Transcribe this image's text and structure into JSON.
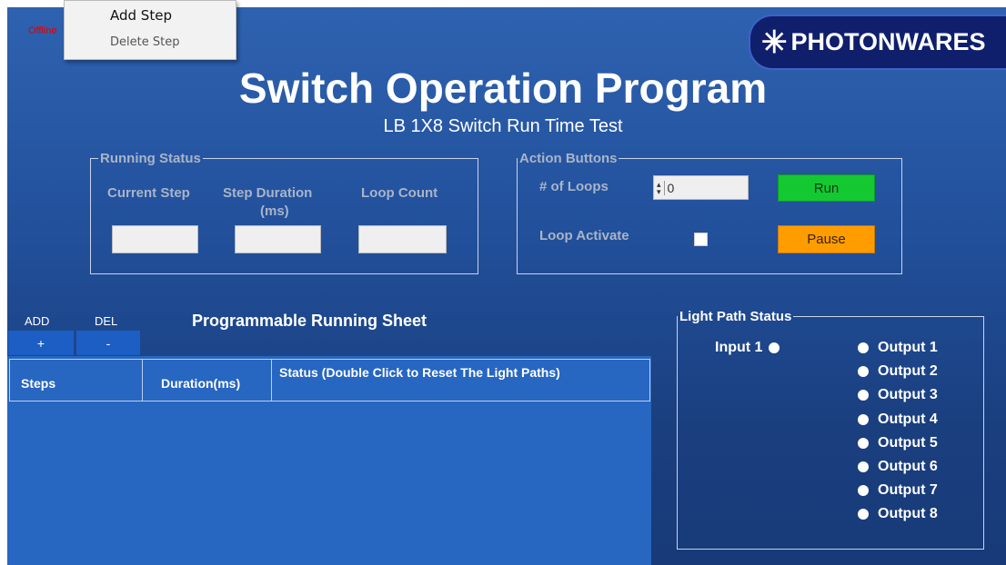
{
  "status": "Offline",
  "context_menu": {
    "items": [
      "Add Step",
      "Delete Step"
    ]
  },
  "logo_text": "PHOTONWARES",
  "title": "Switch Operation Program",
  "subtitle": "LB 1X8 Switch Run Time Test",
  "running_status": {
    "legend": "Running Status",
    "current_step_label": "Current Step",
    "step_duration_label": "Step Duration",
    "step_duration_unit": "(ms)",
    "loop_count_label": "Loop Count",
    "current_step_value": "",
    "step_duration_value": "",
    "loop_count_value": ""
  },
  "action_buttons": {
    "legend": "Action Buttons",
    "loops_label": "# of Loops",
    "loops_value": "0",
    "loop_activate_label": "Loop Activate",
    "loop_activate_checked": false,
    "run_label": "Run",
    "pause_label": "Pause"
  },
  "sheet": {
    "add_label": "ADD",
    "add_symbol": "+",
    "del_label": "DEL",
    "del_symbol": "-",
    "title": "Programmable Running Sheet",
    "columns": [
      "Steps",
      "Duration(ms)",
      "Status (Double Click to Reset The Light Paths)"
    ],
    "rows": []
  },
  "light_path": {
    "legend": "Light Path Status",
    "input": "Input 1",
    "outputs": [
      "Output 1",
      "Output 2",
      "Output 3",
      "Output 4",
      "Output 5",
      "Output 6",
      "Output 7",
      "Output 8"
    ]
  },
  "colors": {
    "run": "#14c832",
    "pause": "#ff9c00",
    "offline": "#e00000",
    "grid": "#2766c1"
  }
}
